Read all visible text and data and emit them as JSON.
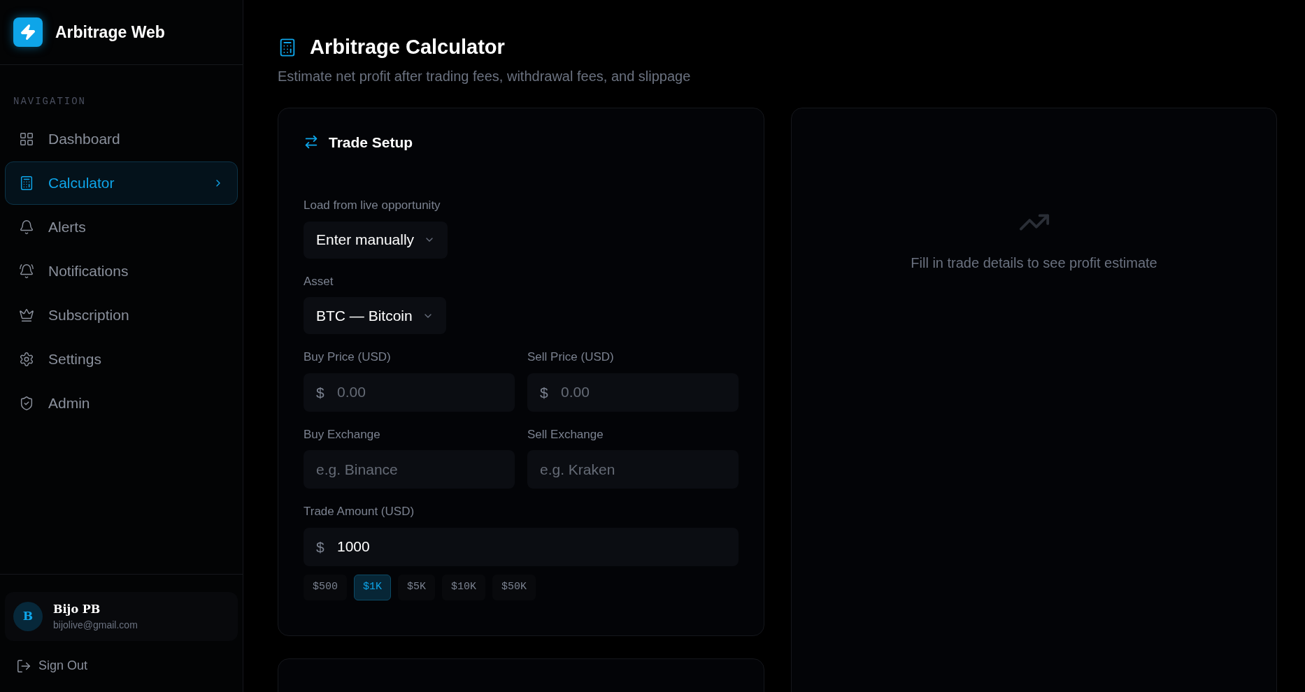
{
  "sidebar": {
    "brand": "Arbitrage Web",
    "section_label": "NAVIGATION",
    "items": [
      {
        "label": "Dashboard",
        "selected": false
      },
      {
        "label": "Calculator",
        "selected": true
      },
      {
        "label": "Alerts",
        "selected": false
      },
      {
        "label": "Notifications",
        "selected": false
      },
      {
        "label": "Subscription",
        "selected": false
      },
      {
        "label": "Settings",
        "selected": false
      },
      {
        "label": "Admin",
        "selected": false
      }
    ],
    "user": {
      "initial": "B",
      "name": "Bijo PB",
      "email": "bijolive@gmail.com"
    },
    "sign_out": "Sign Out"
  },
  "page": {
    "title": "Arbitrage Calculator",
    "subtitle": "Estimate net profit after trading fees, withdrawal fees, and slippage"
  },
  "trade_setup": {
    "title": "Trade Setup",
    "opportunity": {
      "label": "Load from live opportunity",
      "value": "Enter manually"
    },
    "asset": {
      "label": "Asset",
      "value": "BTC — Bitcoin"
    },
    "fields": [
      {
        "label": "Buy Price (USD)",
        "prefix": "$",
        "placeholder": "0.00"
      },
      {
        "label": "Sell Price (USD)",
        "prefix": "$",
        "placeholder": "0.00"
      },
      {
        "label": "Buy Exchange",
        "placeholder": "e.g. Binance"
      },
      {
        "label": "Sell Exchange",
        "placeholder": "e.g. Kraken"
      }
    ],
    "amount": {
      "label": "Trade Amount (USD)",
      "prefix": "$",
      "value": "1000"
    },
    "presets": [
      {
        "label": "$500",
        "selected": false
      },
      {
        "label": "$1K",
        "selected": true
      },
      {
        "label": "$5K",
        "selected": false
      },
      {
        "label": "$10K",
        "selected": false
      },
      {
        "label": "$50K",
        "selected": false
      }
    ]
  },
  "result": {
    "empty_message": "Fill in trade details to see profit estimate"
  }
}
